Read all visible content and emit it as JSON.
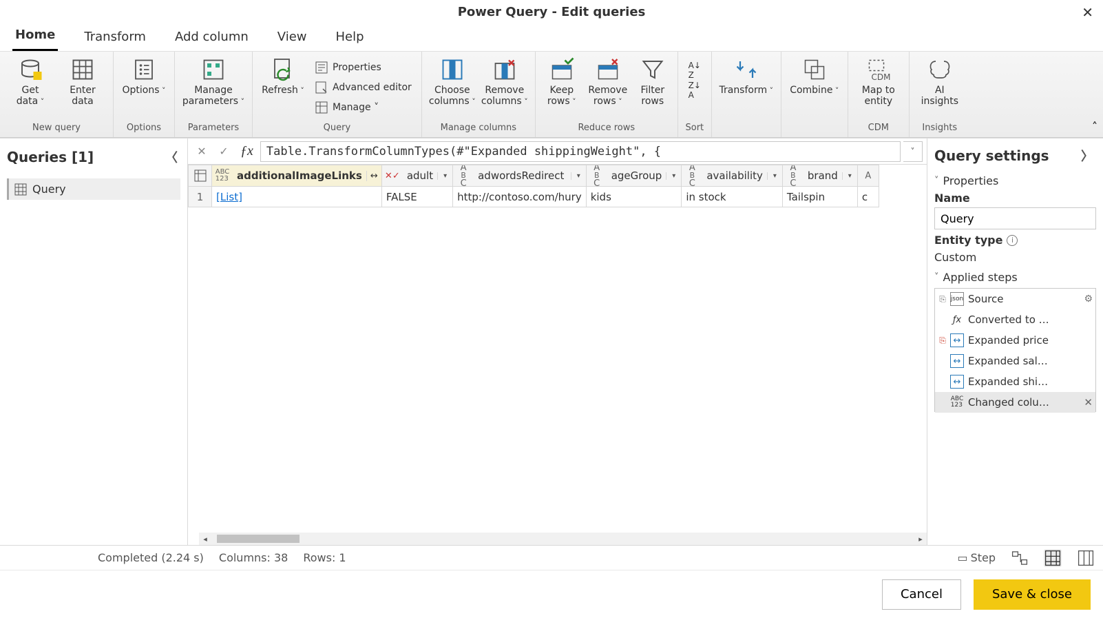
{
  "window": {
    "title": "Power Query - Edit queries"
  },
  "tabs": [
    "Home",
    "Transform",
    "Add column",
    "View",
    "Help"
  ],
  "ribbon": {
    "groups": {
      "new_query": {
        "label": "New query",
        "get_data": "Get\ndata",
        "enter_data": "Enter\ndata"
      },
      "options_g": {
        "label": "Options",
        "options": "Options"
      },
      "parameters_g": {
        "label": "Parameters",
        "manage_parameters": "Manage\nparameters"
      },
      "query_g": {
        "label": "Query",
        "refresh": "Refresh",
        "properties": "Properties",
        "advanced_editor": "Advanced editor",
        "manage": "Manage"
      },
      "manage_cols": {
        "label": "Manage columns",
        "choose": "Choose\ncolumns",
        "remove": "Remove\ncolumns"
      },
      "reduce_rows": {
        "label": "Reduce rows",
        "keep": "Keep\nrows",
        "remove": "Remove\nrows",
        "filter": "Filter\nrows"
      },
      "sort_g": {
        "label": "Sort"
      },
      "transform_g": {
        "label": "",
        "transform": "Transform"
      },
      "combine_g": {
        "label": "",
        "combine": "Combine"
      },
      "cdm_g": {
        "label": "CDM",
        "map": "Map to\nentity"
      },
      "insights_g": {
        "label": "Insights",
        "ai": "AI\ninsights"
      }
    }
  },
  "queries": {
    "header": "Queries [1]",
    "item": "Query"
  },
  "formula": "Table.TransformColumnTypes(#\"Expanded shippingWeight\", {",
  "columns": [
    {
      "name": "additionalImageLinks",
      "type": "any",
      "selected": true,
      "expand": true
    },
    {
      "name": "adult",
      "type": "bool"
    },
    {
      "name": "adwordsRedirect",
      "type": "text"
    },
    {
      "name": "ageGroup",
      "type": "text"
    },
    {
      "name": "availability",
      "type": "text"
    },
    {
      "name": "brand",
      "type": "text"
    }
  ],
  "rows": [
    {
      "n": "1",
      "cells": [
        "[List]",
        "FALSE",
        "http://contoso.com/hury",
        "kids",
        "in stock",
        "Tailspin"
      ]
    }
  ],
  "settings": {
    "title": "Query settings",
    "properties": "Properties",
    "name_label": "Name",
    "name_value": "Query",
    "entity_type": "Entity type",
    "entity_value": "Custom",
    "applied_steps": "Applied steps",
    "steps": [
      {
        "label": "Source",
        "gear": true,
        "mark": "json"
      },
      {
        "label": "Converted to …",
        "fx": true
      },
      {
        "label": "Expanded price",
        "mark": "red"
      },
      {
        "label": "Expanded sal…"
      },
      {
        "label": "Expanded shi…"
      },
      {
        "label": "Changed colu…",
        "sel": true,
        "x": true
      }
    ]
  },
  "status": {
    "completed": "Completed (2.24 s)",
    "columns": "Columns: 38",
    "rows": "Rows: 1",
    "step": "Step"
  },
  "footer": {
    "cancel": "Cancel",
    "save": "Save & close"
  }
}
